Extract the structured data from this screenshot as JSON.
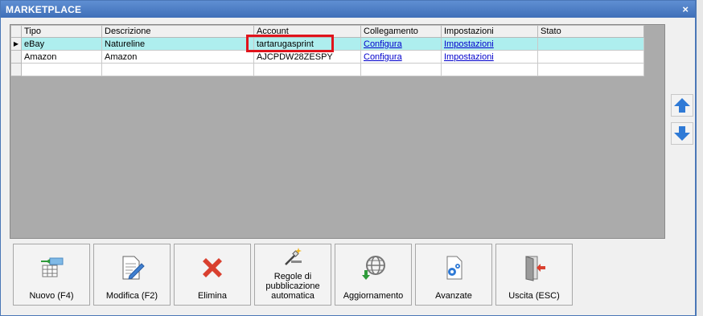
{
  "window": {
    "title": "MARKETPLACE",
    "close_symbol": "×"
  },
  "grid": {
    "columns": [
      "Tipo",
      "Descrizione",
      "Account",
      "Collegamento",
      "Impostazioni",
      "Stato"
    ],
    "rows": [
      {
        "tipo": "eBay",
        "descrizione": "Natureline",
        "account": "tartarugasprint",
        "collegamento": "Configura",
        "impostazioni": "Impostazioni",
        "stato": "",
        "selected": true
      },
      {
        "tipo": "Amazon",
        "descrizione": "Amazon",
        "account": "AJCPDW28ZESPY",
        "collegamento": "Configura",
        "impostazioni": "Impostazioni",
        "stato": "",
        "selected": false
      }
    ],
    "row_indicator": "▶"
  },
  "side_buttons": {
    "up_icon": "arrow-up-icon",
    "down_icon": "arrow-down-icon",
    "color": "#2f7ad6"
  },
  "toolbar": {
    "new_label": "Nuovo (F4)",
    "edit_label": "Modifica (F2)",
    "delete_label": "Elimina",
    "rules_label_line1": "Regole di",
    "rules_label_line2": "pubblicazione",
    "rules_label_line3": "automatica",
    "update_label": "Aggiornamento",
    "advanced_label": "Avanzate",
    "exit_label": "Uscita (ESC)"
  },
  "colors": {
    "title_bar": "#4a7cc4",
    "selected_row": "#aeeeee",
    "highlight": "#e0141c",
    "delete_red": "#d9402f"
  }
}
